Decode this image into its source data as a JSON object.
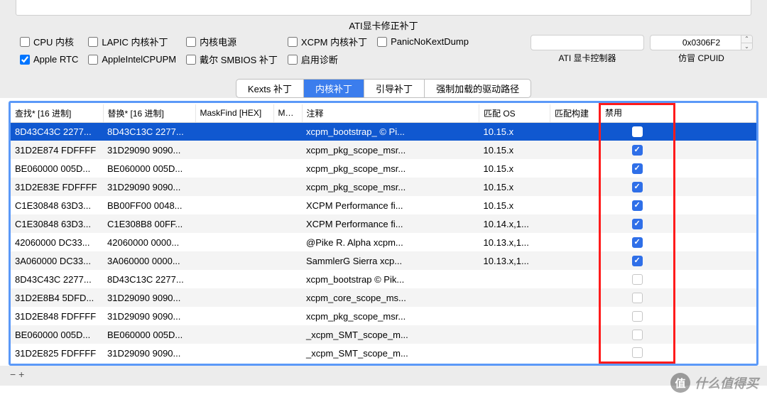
{
  "title": "ATI显卡修正补丁",
  "options": [
    [
      {
        "label": "CPU 内核",
        "checked": false
      },
      {
        "label": "LAPIC 内核补丁",
        "checked": false
      },
      {
        "label": "内核电源",
        "checked": false
      },
      {
        "label": "XCPM 内核补丁",
        "checked": false
      },
      {
        "label": "PanicNoKextDump",
        "checked": false
      }
    ],
    [
      {
        "label": "Apple RTC",
        "checked": true
      },
      {
        "label": "AppleIntelCPUPM",
        "checked": false
      },
      {
        "label": "戴尔 SMBIOS 补丁",
        "checked": false
      },
      {
        "label": "启用诊断",
        "checked": false
      }
    ]
  ],
  "right": {
    "controller": {
      "value": "",
      "label": "ATI 显卡控制器"
    },
    "cpuid": {
      "value": "0x0306F2",
      "label": "仿冒 CPUID"
    }
  },
  "tabs": [
    "Kexts 补丁",
    "内核补丁",
    "引导补丁",
    "强制加载的驱动路径"
  ],
  "active_tab": 1,
  "columns": [
    "查找* [16 进制]",
    "替换* [16 进制]",
    "MaskFind [HEX]",
    "Mas...",
    "注释",
    "匹配 OS",
    "匹配构建",
    "禁用",
    ""
  ],
  "rows": [
    {
      "selected": true,
      "find": "8D43C43C 2277...",
      "replace": "8D43C13C 2277...",
      "mf": "",
      "mr": "",
      "comment": "xcpm_bootstrap_ © Pi...",
      "os": "10.15.x",
      "build": "",
      "disabled": false
    },
    {
      "find": "31D2E874 FDFFFF",
      "replace": "31D29090 9090...",
      "mf": "",
      "mr": "",
      "comment": "xcpm_pkg_scope_msr...",
      "os": "10.15.x",
      "build": "",
      "disabled": true
    },
    {
      "find": "BE060000 005D...",
      "replace": "BE060000 005D...",
      "mf": "",
      "mr": "",
      "comment": "xcpm_pkg_scope_msr...",
      "os": "10.15.x",
      "build": "",
      "disabled": true
    },
    {
      "find": "31D2E83E FDFFFF",
      "replace": "31D29090 9090...",
      "mf": "",
      "mr": "",
      "comment": "xcpm_pkg_scope_msr...",
      "os": "10.15.x",
      "build": "",
      "disabled": true
    },
    {
      "find": "C1E30848 63D3...",
      "replace": "BB00FF00 0048...",
      "mf": "",
      "mr": "",
      "comment": "XCPM Performance fi...",
      "os": "10.15.x",
      "build": "",
      "disabled": true
    },
    {
      "find": "C1E30848 63D3...",
      "replace": "C1E308B8 00FF...",
      "mf": "",
      "mr": "",
      "comment": "XCPM Performance fi...",
      "os": "10.14.x,1...",
      "build": "",
      "disabled": true
    },
    {
      "find": "42060000 DC33...",
      "replace": "42060000 0000...",
      "mf": "",
      "mr": "",
      "comment": "@Pike R. Alpha xcpm...",
      "os": "10.13.x,1...",
      "build": "",
      "disabled": true
    },
    {
      "find": "3A060000 DC33...",
      "replace": "3A060000 0000...",
      "mf": "",
      "mr": "",
      "comment": "SammlerG Sierra xcp...",
      "os": "10.13.x,1...",
      "build": "",
      "disabled": true
    },
    {
      "find": "8D43C43C 2277...",
      "replace": "8D43C13C 2277...",
      "mf": "",
      "mr": "",
      "comment": "xcpm_bootstrap © Pik...",
      "os": "",
      "build": "",
      "disabled": false
    },
    {
      "find": "31D2E8B4 5DFD...",
      "replace": "31D29090 9090...",
      "mf": "",
      "mr": "",
      "comment": "xcpm_core_scope_ms...",
      "os": "",
      "build": "",
      "disabled": false
    },
    {
      "find": "31D2E848 FDFFFF",
      "replace": "31D29090 9090...",
      "mf": "",
      "mr": "",
      "comment": "xcpm_pkg_scope_msr...",
      "os": "",
      "build": "",
      "disabled": false
    },
    {
      "find": "BE060000 005D...",
      "replace": "BE060000 005D...",
      "mf": "",
      "mr": "",
      "comment": "_xcpm_SMT_scope_m...",
      "os": "",
      "build": "",
      "disabled": false
    },
    {
      "find": "31D2E825 FDFFFF",
      "replace": "31D29090 9090...",
      "mf": "",
      "mr": "",
      "comment": "_xcpm_SMT_scope_m...",
      "os": "",
      "build": "",
      "disabled": false
    }
  ],
  "footer_remove": "−",
  "footer_add": "+",
  "watermark": "什么值得买"
}
